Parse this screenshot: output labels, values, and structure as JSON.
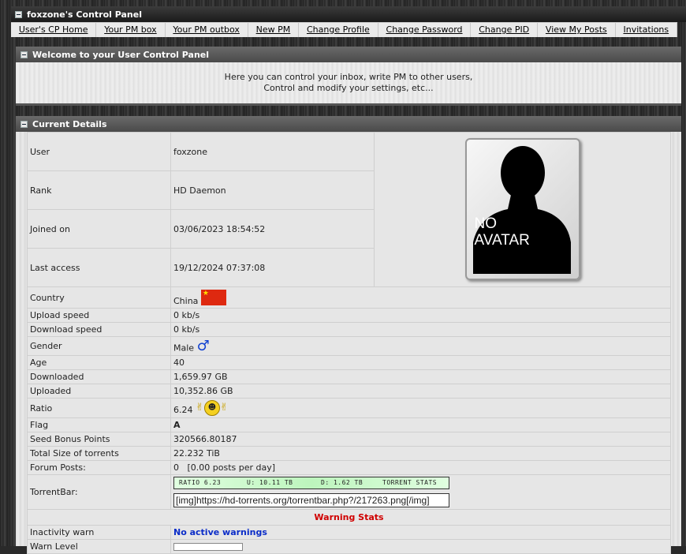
{
  "window": {
    "title": "foxzone's Control Panel"
  },
  "nav": [
    "User's CP Home",
    "Your PM box",
    "Your PM outbox",
    "New PM",
    "Change Profile",
    "Change Password",
    "Change PID",
    "View My Posts",
    "Invitations"
  ],
  "welcome": {
    "title": "Welcome to your User Control Panel",
    "line1": "Here you can control your inbox, write PM to other users,",
    "line2": "Control and modify your settings, etc..."
  },
  "details": {
    "title": "Current Details",
    "avatar": {
      "line1": "NO",
      "line2": "AVATAR"
    },
    "rows": {
      "user": {
        "label": "User",
        "value": "foxzone"
      },
      "rank": {
        "label": "Rank",
        "value": "HD Daemon"
      },
      "joined": {
        "label": "Joined on",
        "value": "03/06/2023 18:54:52"
      },
      "last_access": {
        "label": "Last access",
        "value": "19/12/2024 07:37:08"
      },
      "country": {
        "label": "Country",
        "value": "China"
      },
      "upload_speed": {
        "label": "Upload speed",
        "value": "0 kb/s"
      },
      "download_speed": {
        "label": "Download speed",
        "value": "0 kb/s"
      },
      "gender": {
        "label": "Gender",
        "value": "Male",
        "symbol": "♂"
      },
      "age": {
        "label": "Age",
        "value": "40"
      },
      "downloaded": {
        "label": "Downloaded",
        "value": "1,659.97 GB"
      },
      "uploaded": {
        "label": "Uploaded",
        "value": "10,352.86 GB"
      },
      "ratio": {
        "label": "Ratio",
        "value": "6.24"
      },
      "flag": {
        "label": "Flag",
        "value": "A"
      },
      "seed_bonus": {
        "label": "Seed Bonus Points",
        "value": "320566.80187"
      },
      "total_size": {
        "label": "Total Size of torrents",
        "value": "22.232 TiB"
      },
      "forum_posts": {
        "label": "Forum Posts:",
        "value": "0",
        "per_day": "[0.00 posts per day]"
      },
      "torrentbar": {
        "label": "TorrentBar:",
        "ratio": "RATIO 6.23",
        "up": "U: 10.11 TB",
        "down": "D: 1.62 TB",
        "stats": "TORRENT STATS",
        "code": "[img]https://hd-torrents.org/torrentbar.php?/217263.png[/img]"
      }
    },
    "warning_stats": "Warning Stats",
    "inactivity": {
      "label": "Inactivity warn",
      "value": "No active warnings"
    },
    "warn_level": {
      "label": "Warn Level"
    }
  },
  "colors": {
    "warning_title": "#d00000",
    "no_warnings": "#0a2cc8",
    "flag_red": "#de2910"
  }
}
